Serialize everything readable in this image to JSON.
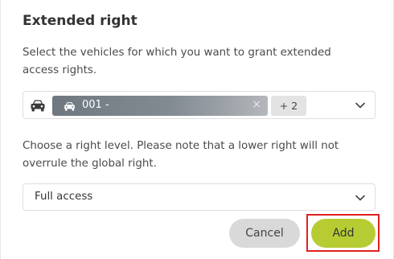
{
  "dialog": {
    "title": "Extended right",
    "vehicles_description": "Select the vehicles for which you want to grant extended access rights.",
    "level_description": "Choose a right level. Please note that a lower right will not overrule the global right."
  },
  "vehicle_select": {
    "icon": "car-icon",
    "selected_chip": {
      "icon": "car-icon",
      "label": "001 -",
      "remove_symbol": "×"
    },
    "more_count": "+ 2"
  },
  "level_select": {
    "value": "Full access"
  },
  "actions": {
    "cancel_label": "Cancel",
    "add_label": "Add"
  },
  "colors": {
    "add_button": "#b7cc33",
    "cancel_button": "#d9d9d9",
    "highlight": "#e02020",
    "chip": "#7b848b"
  }
}
